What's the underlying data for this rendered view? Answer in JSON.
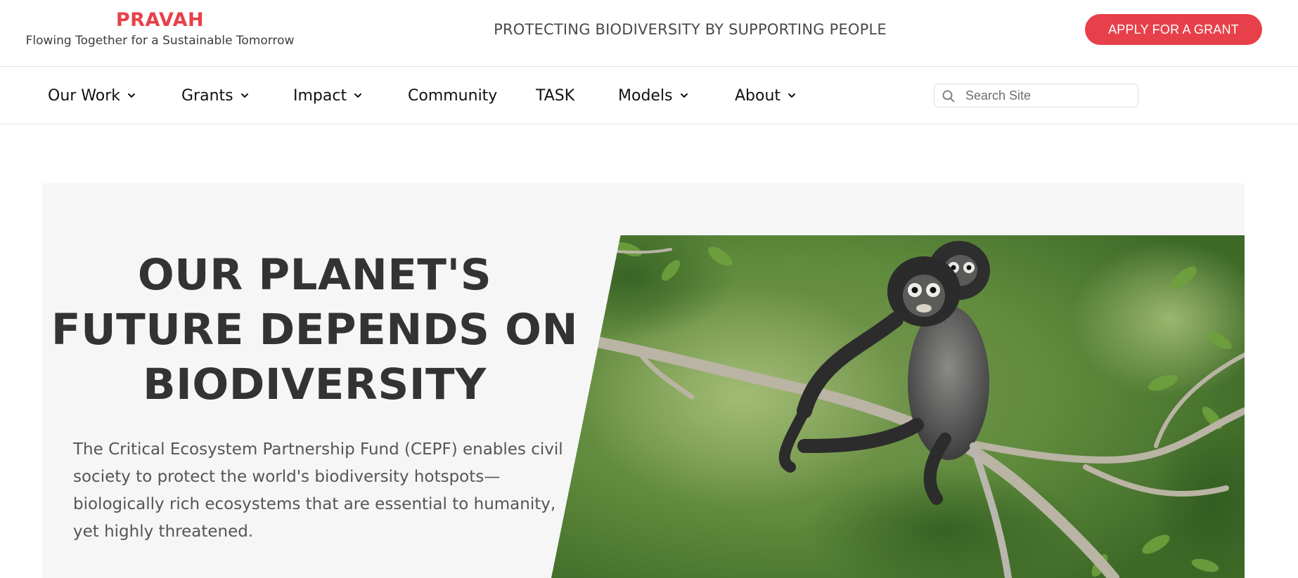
{
  "header": {
    "brand_name": "PRAVAH",
    "brand_tagline": "Flowing Together for a Sustainable Tomorrow",
    "center_tagline": "PROTECTING BIODIVERSITY BY SUPPORTING PEOPLE",
    "cta_label": "APPLY FOR A GRANT"
  },
  "nav": {
    "items": [
      {
        "label": "Our Work",
        "has_dropdown": true
      },
      {
        "label": "Grants",
        "has_dropdown": true
      },
      {
        "label": "Impact",
        "has_dropdown": true
      },
      {
        "label": "Community",
        "has_dropdown": false
      },
      {
        "label": "TASK",
        "has_dropdown": false
      },
      {
        "label": "Models",
        "has_dropdown": true
      },
      {
        "label": "About",
        "has_dropdown": true
      }
    ],
    "search_placeholder": "Search Site",
    "search_value": ""
  },
  "hero": {
    "title_lines": [
      "OUR PLANET'S",
      "FUTURE DEPENDS ON",
      "BIODIVERSITY"
    ],
    "description": "The Critical Ecosystem Partnership Fund (CEPF) enables civil society to protect the world's biodiversity hotspots—biologically rich ecosystems that are essential to humanity, yet highly threatened.",
    "image_icon": "langur-monkeys-on-branch-photo"
  },
  "colors": {
    "accent": "#e8404a",
    "hero_background": "#f6f6f6",
    "text_dark": "#333333"
  }
}
